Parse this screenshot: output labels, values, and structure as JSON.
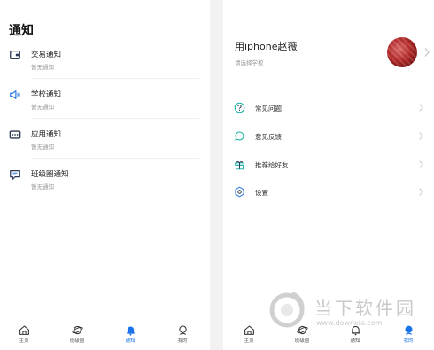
{
  "left": {
    "title": "通知",
    "items": [
      {
        "label": "交易通知",
        "sub": "暂无通知",
        "icon": "wallet-icon"
      },
      {
        "label": "学校通知",
        "sub": "暂无通知",
        "icon": "speaker-icon"
      },
      {
        "label": "应用通知",
        "sub": "暂无通知",
        "icon": "app-dots-icon"
      },
      {
        "label": "班级圈通知",
        "sub": "暂无通知",
        "icon": "chat-icon"
      }
    ],
    "tabs": [
      {
        "label": "主页",
        "icon": "home-icon",
        "active": false
      },
      {
        "label": "班级圈",
        "icon": "planet-icon",
        "active": false
      },
      {
        "label": "通知",
        "icon": "bell-icon",
        "active": true
      },
      {
        "label": "我的",
        "icon": "profile-icon",
        "active": false
      }
    ]
  },
  "right": {
    "profile": {
      "name": "用iphone赵薇",
      "school_prompt": "请选择学校"
    },
    "menu": [
      {
        "label": "常见问题",
        "icon": "help-icon"
      },
      {
        "label": "意见反馈",
        "icon": "feedback-icon"
      },
      {
        "label": "推荐给好友",
        "icon": "gift-icon"
      },
      {
        "label": "设置",
        "icon": "settings-icon"
      }
    ],
    "tabs": [
      {
        "label": "主页",
        "icon": "home-icon",
        "active": false
      },
      {
        "label": "班级圈",
        "icon": "planet-icon",
        "active": false
      },
      {
        "label": "通知",
        "icon": "bell-icon",
        "active": false
      },
      {
        "label": "我的",
        "icon": "profile-icon",
        "active": true
      }
    ]
  },
  "watermark": {
    "text": "当下软件园",
    "url": "www.downxia.com"
  },
  "colors": {
    "accent": "#1a73e8",
    "icon_blue": "#2f7be5",
    "icon_teal": "#1eb3a3"
  }
}
